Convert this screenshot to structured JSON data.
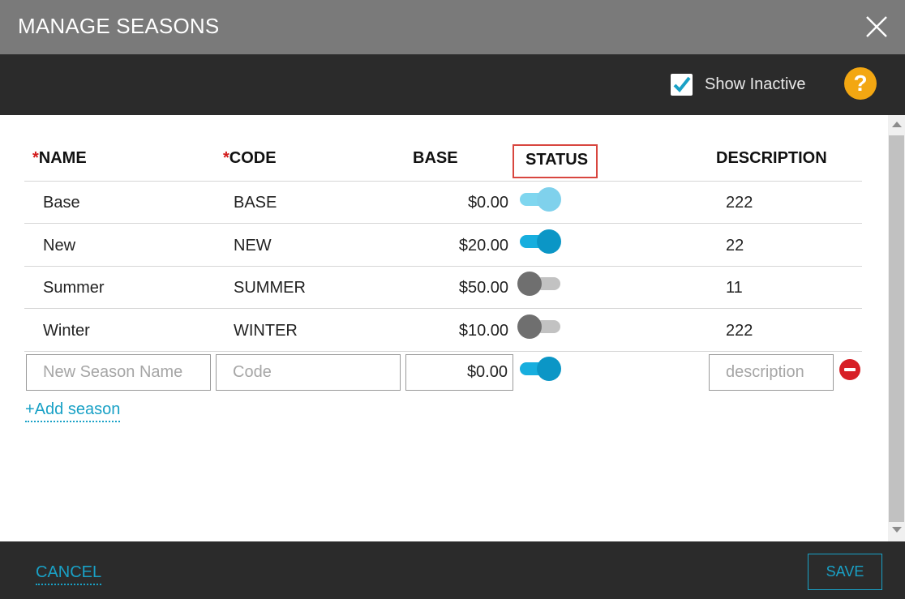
{
  "dialog": {
    "title": "MANAGE SEASONS"
  },
  "toolbar": {
    "show_inactive_label": "Show Inactive",
    "show_inactive_checked": true,
    "help_label": "?"
  },
  "table": {
    "headers": {
      "required_marker": "*",
      "name": "NAME",
      "code": "CODE",
      "base": "BASE",
      "status": "STATUS",
      "description": "DESCRIPTION"
    },
    "rows": [
      {
        "name": "Base",
        "code": "BASE",
        "base": "$0.00",
        "status": "active",
        "description": "222"
      },
      {
        "name": "New",
        "code": "NEW",
        "base": "$20.00",
        "status": "active",
        "description": "22"
      },
      {
        "name": "Summer",
        "code": "SUMMER",
        "base": "$50.00",
        "status": "inactive",
        "description": "11"
      },
      {
        "name": "Winter",
        "code": "WINTER",
        "base": "$10.00",
        "status": "inactive",
        "description": "222"
      }
    ],
    "new_row": {
      "name_placeholder": "New Season Name",
      "code_placeholder": "Code",
      "base_value": "$0.00",
      "status": "active",
      "description_placeholder": "description"
    }
  },
  "actions": {
    "add_season": "+Add season",
    "cancel": "CANCEL",
    "save": "SAVE"
  },
  "colors": {
    "accent": "#19a1c6",
    "toggle_on": "#0b96c6",
    "toggle_off": "#6f6f6f",
    "help": "#f3a712",
    "required": "#d21a1a",
    "highlight": "#d8463f",
    "remove": "#d71f26"
  }
}
